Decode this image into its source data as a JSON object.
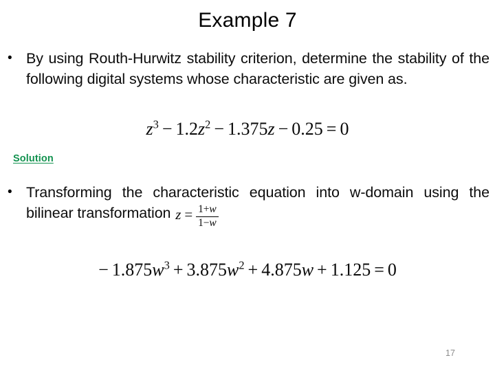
{
  "slide": {
    "title": "Example 7",
    "page_number": "17",
    "background_color": "#ffffff",
    "text_color": "#0c0c0c",
    "accent_color": "#12924f",
    "page_number_color": "#8c8c8c"
  },
  "bullets": [
    {
      "marker": "•",
      "text": "By using Routh-Hurwitz stability criterion, determine the stability of the following digital systems whose characteristic are given as."
    },
    {
      "marker": "•",
      "lead_text": "Transforming the characteristic equation into w-domain using the bilinear transformation ",
      "inline_math": {
        "lhs": "z",
        "relation": "=",
        "numerator_prefix": "1+",
        "numerator_var": "w",
        "denominator_prefix": "1−",
        "denominator_var": "w"
      }
    }
  ],
  "solution_label": "Solution",
  "equations": [
    {
      "name": "characteristic-equation-z-domain",
      "plain": "z^3 − 1.2z^2 − 1.375z − 0.25 = 0",
      "terms": [
        {
          "coefficient": "",
          "variable": "z",
          "exponent": "3"
        },
        {
          "operator": "−",
          "coefficient": "1.2",
          "variable": "z",
          "exponent": "2"
        },
        {
          "operator": "−",
          "coefficient": "1.375",
          "variable": "z",
          "exponent": ""
        },
        {
          "operator": "−",
          "coefficient": "0.25",
          "variable": "",
          "exponent": ""
        }
      ],
      "relation": "=",
      "rhs": "0"
    },
    {
      "name": "characteristic-equation-w-domain",
      "plain": "−1.875w^3 + 3.875w^2 + 4.875w + 1.125 = 0",
      "terms": [
        {
          "operator": "−",
          "coefficient": "1.875",
          "variable": "w",
          "exponent": "3"
        },
        {
          "operator": "+",
          "coefficient": "3.875",
          "variable": "w",
          "exponent": "2"
        },
        {
          "operator": "+",
          "coefficient": "4.875",
          "variable": "w",
          "exponent": ""
        },
        {
          "operator": "+",
          "coefficient": "1.125",
          "variable": "",
          "exponent": ""
        }
      ],
      "relation": "=",
      "rhs": "0"
    }
  ]
}
